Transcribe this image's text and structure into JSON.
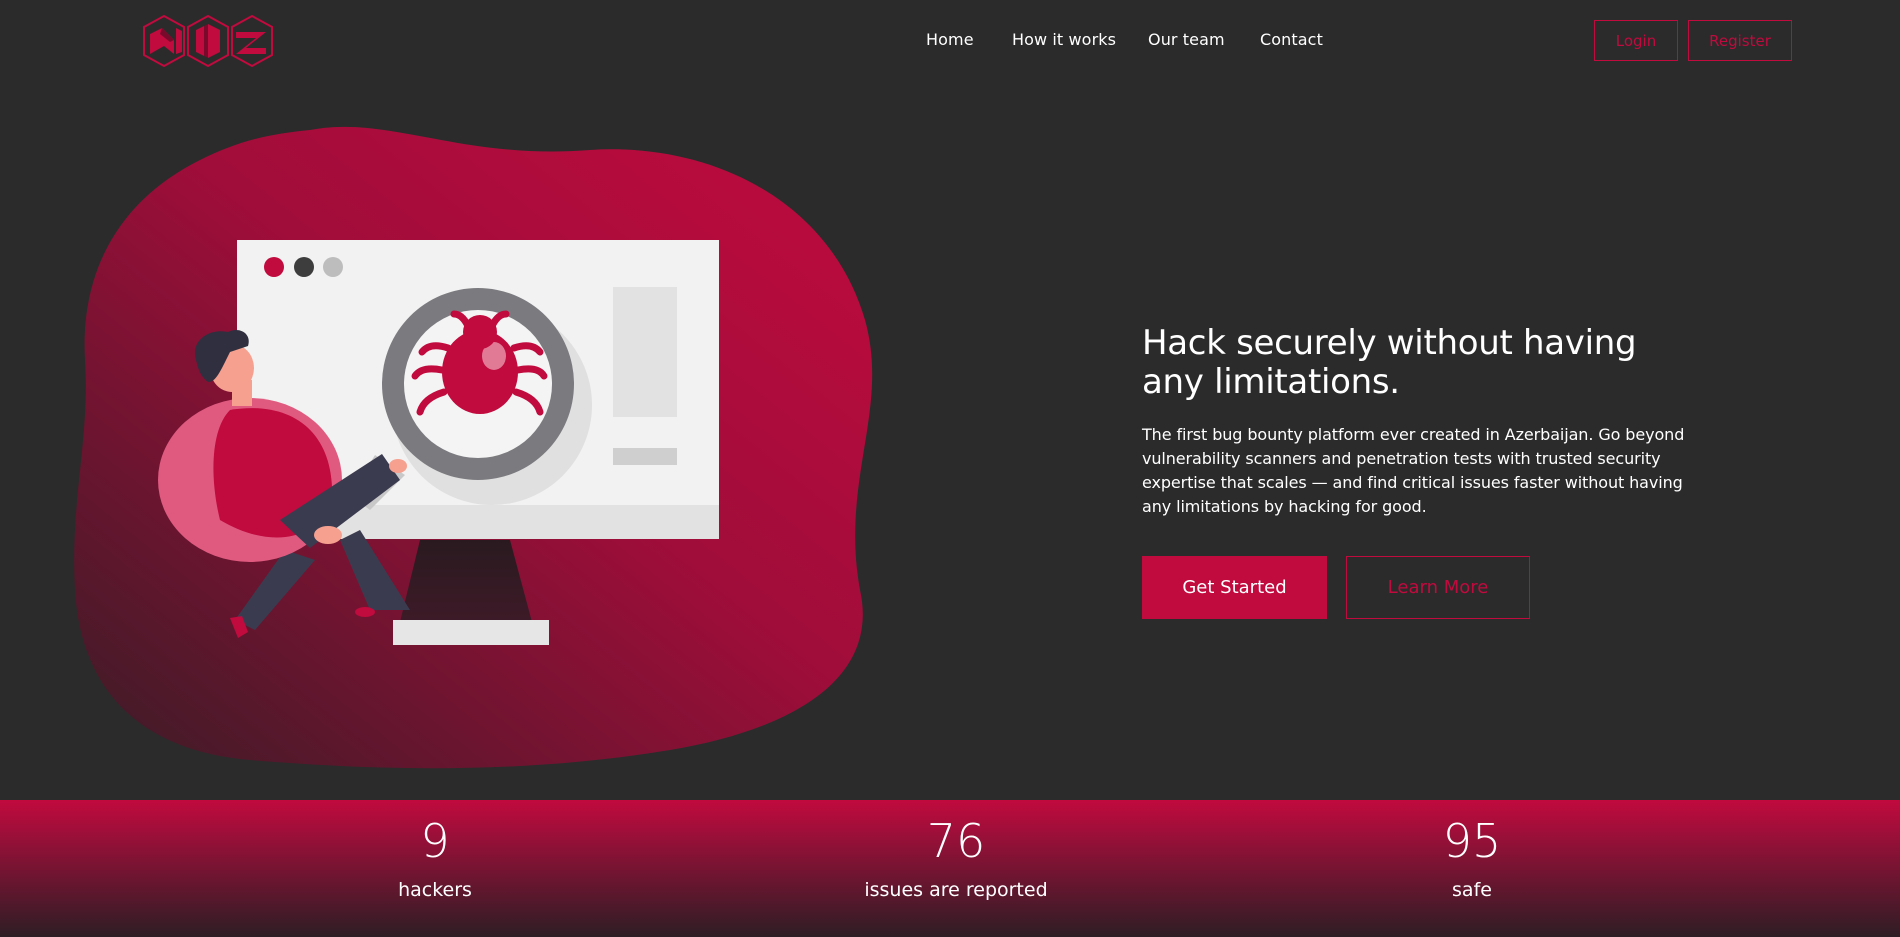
{
  "brand": {
    "accent": "#c10a3e",
    "background": "#2b2b2b",
    "logo_icon": "hexagon-logo-icon"
  },
  "nav": {
    "items": [
      {
        "label": "Home"
      },
      {
        "label": "How it works"
      },
      {
        "label": "Our team"
      },
      {
        "label": "Contact"
      }
    ]
  },
  "auth": {
    "login_label": "Login",
    "register_label": "Register"
  },
  "hero": {
    "title": "Hack securely without having any limitations.",
    "description": "The first bug bounty platform ever created in Azerbaijan. Go beyond vulnerability scanners and penetration tests with trusted security expertise that scales — and find critical issues faster without having any limitations by hacking for good.",
    "primary_cta": "Get Started",
    "secondary_cta": "Learn More",
    "illustration_icon": "bug-search-illustration"
  },
  "stats": [
    {
      "value": "9",
      "label": "hackers"
    },
    {
      "value": "76",
      "label": "issues are reported"
    },
    {
      "value": "95",
      "label": "safe"
    }
  ]
}
